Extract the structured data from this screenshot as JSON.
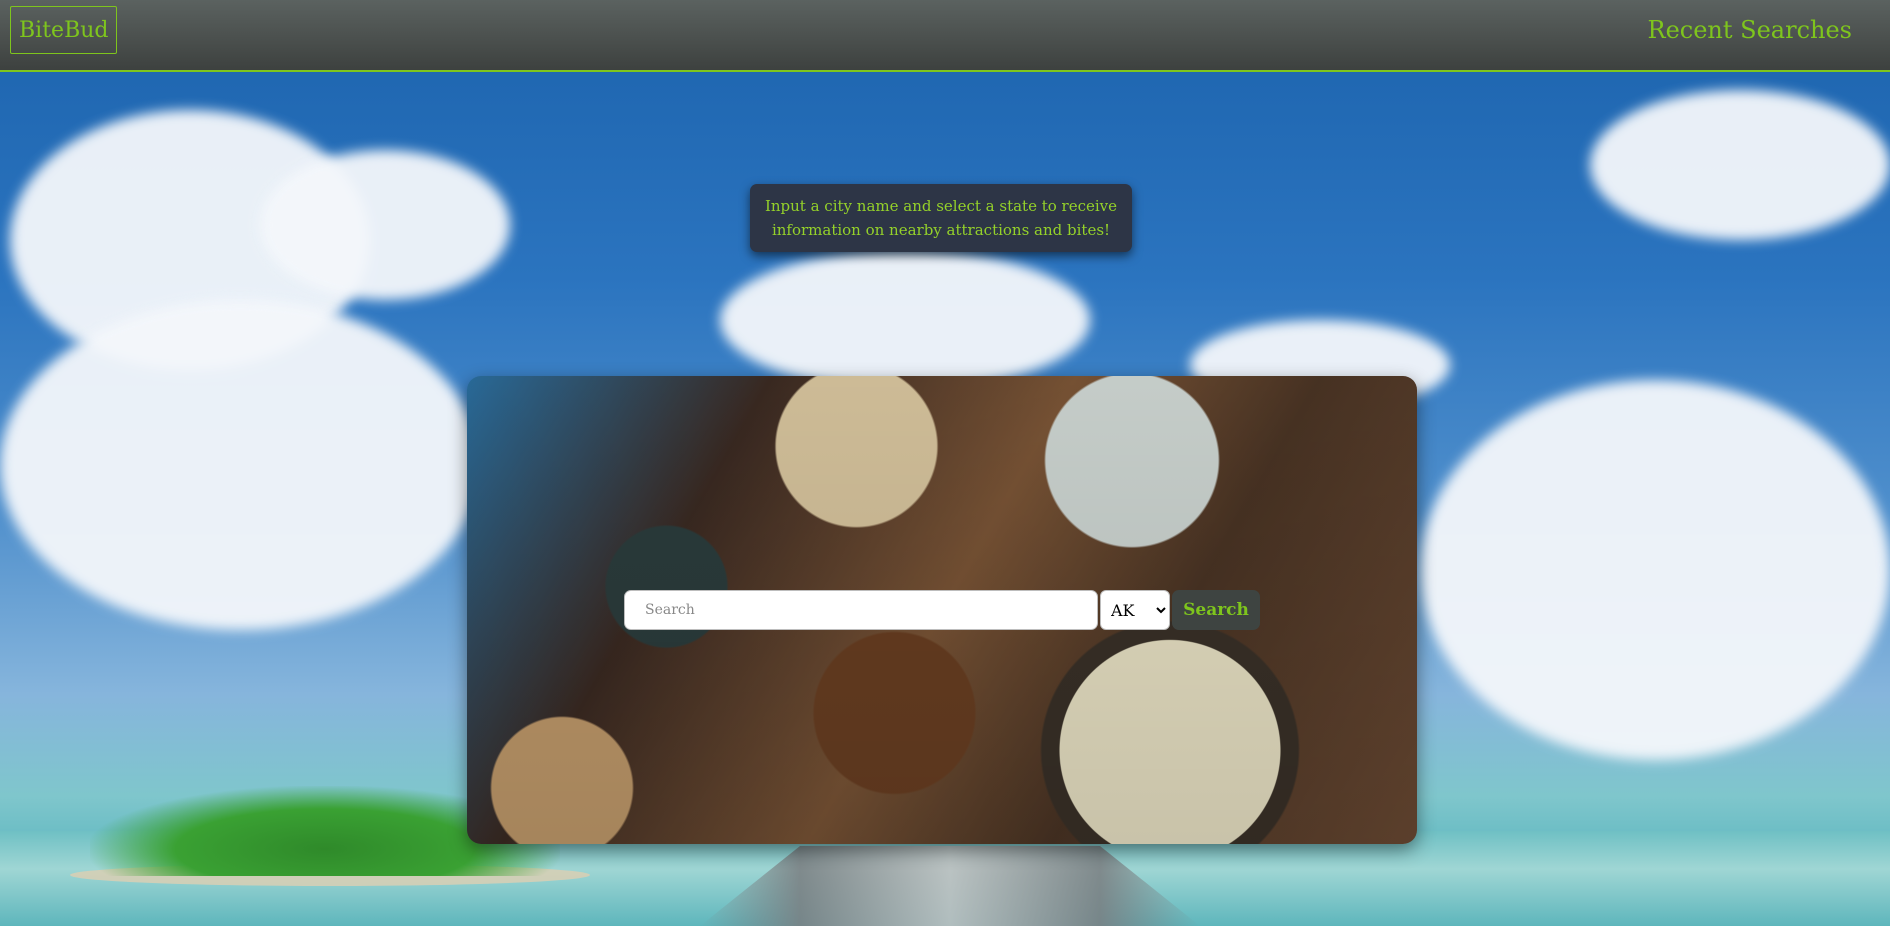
{
  "header": {
    "brand": "BiteBud",
    "recent_searches_label": "Recent Searches"
  },
  "hint": {
    "text": "Input a city name and select a state to receive information on nearby attractions and bites!"
  },
  "search": {
    "placeholder": "Search",
    "value": "",
    "state_selected": "AK",
    "button_label": "Search"
  },
  "colors": {
    "accent": "#7ec51d",
    "navbar": "#4b504e",
    "hint_bg": "#2d3546"
  }
}
